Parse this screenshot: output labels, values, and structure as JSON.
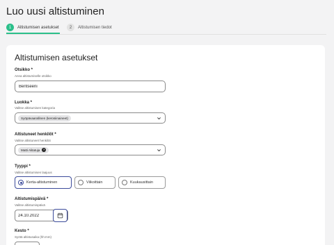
{
  "page": {
    "title": "Luo uusi altistuminen"
  },
  "stepper": {
    "steps": [
      {
        "number": "1",
        "label": "Altistumisen asetukset",
        "active": true
      },
      {
        "number": "2",
        "label": "Altistumisen tiedot",
        "active": false
      }
    ],
    "accent_color": "#2bbf8a"
  },
  "form": {
    "title": "Altistumisen asetukset",
    "otsikko": {
      "label": "Otsikko *",
      "help": "Anna altistumiselle otsikko",
      "value": "Bentseeni"
    },
    "luokka": {
      "label": "Luokka *",
      "help": "Valitse altistumisen kategoria",
      "selected_chip": "Syöpävaarallinen (kerosiinaineet)"
    },
    "henkilot": {
      "label": "Altistuneet henkilöt *",
      "help": "Valitse altistuneet henkilöt",
      "selected_chip": "Matti Alitatuja"
    },
    "tyyppi": {
      "label": "Tyyppi *",
      "help": "Valitse altistumisen laajuus",
      "options": [
        "Kerta-altistuminen",
        "Viikoittain",
        "Kuukausittain"
      ],
      "selected": "Kerta-altistuminen"
    },
    "paiva": {
      "label": "Altistumispäivä *",
      "help": "Valitse altistumispäivä",
      "value": "24.10.2022"
    },
    "kesto": {
      "label": "Kesto *",
      "help": "Syötä altistusaika (hh:mm)"
    }
  },
  "icons": {
    "chevron": "chevron-down-icon",
    "calendar": "calendar-icon",
    "remove": "close-icon"
  },
  "colors": {
    "primary": "#3b4a9a",
    "background": "#f3f3f4"
  }
}
